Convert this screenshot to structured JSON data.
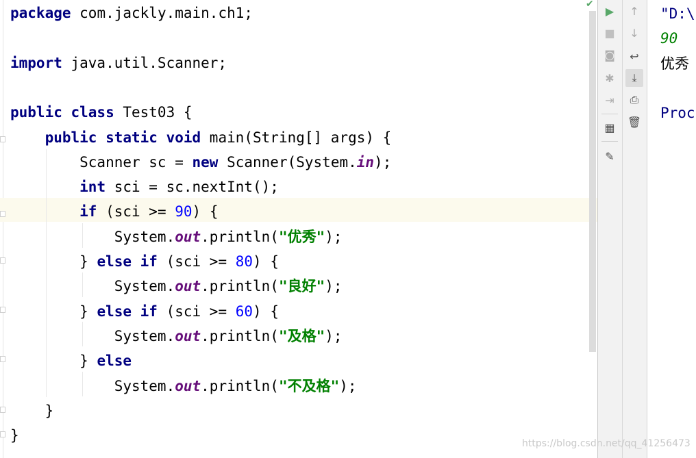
{
  "editor": {
    "lines": [
      [
        {
          "t": "package",
          "c": "kw"
        },
        {
          "t": " com.jackly.main.ch1;",
          "c": ""
        }
      ],
      [],
      [
        {
          "t": "import",
          "c": "kw"
        },
        {
          "t": " java.util.Scanner;",
          "c": ""
        }
      ],
      [],
      [
        {
          "t": "public class",
          "c": "kw"
        },
        {
          "t": " Test03 {",
          "c": ""
        }
      ],
      [
        {
          "t": "    ",
          "c": ""
        },
        {
          "t": "public static void",
          "c": "kw"
        },
        {
          "t": " main(String[] args) {",
          "c": ""
        }
      ],
      [
        {
          "t": "        Scanner sc = ",
          "c": ""
        },
        {
          "t": "new",
          "c": "kw"
        },
        {
          "t": " Scanner(System.",
          "c": ""
        },
        {
          "t": "in",
          "c": "fld"
        },
        {
          "t": ");",
          "c": ""
        }
      ],
      [
        {
          "t": "        ",
          "c": ""
        },
        {
          "t": "int",
          "c": "kw"
        },
        {
          "t": " sci = sc.nextInt();",
          "c": ""
        }
      ],
      [
        {
          "t": "        ",
          "c": ""
        },
        {
          "t": "if",
          "c": "kw"
        },
        {
          "t": " (sci >= ",
          "c": ""
        },
        {
          "t": "90",
          "c": "num"
        },
        {
          "t": ") {",
          "c": ""
        }
      ],
      [
        {
          "t": "            System.",
          "c": ""
        },
        {
          "t": "out",
          "c": "fld"
        },
        {
          "t": ".println(",
          "c": ""
        },
        {
          "t": "\"优秀\"",
          "c": "str"
        },
        {
          "t": ");",
          "c": ""
        }
      ],
      [
        {
          "t": "        } ",
          "c": ""
        },
        {
          "t": "else if",
          "c": "kw"
        },
        {
          "t": " (sci >= ",
          "c": ""
        },
        {
          "t": "80",
          "c": "num"
        },
        {
          "t": ") {",
          "c": ""
        }
      ],
      [
        {
          "t": "            System.",
          "c": ""
        },
        {
          "t": "out",
          "c": "fld"
        },
        {
          "t": ".println(",
          "c": ""
        },
        {
          "t": "\"良好\"",
          "c": "str"
        },
        {
          "t": ");",
          "c": ""
        }
      ],
      [
        {
          "t": "        } ",
          "c": ""
        },
        {
          "t": "else if",
          "c": "kw"
        },
        {
          "t": " (sci >= ",
          "c": ""
        },
        {
          "t": "60",
          "c": "num"
        },
        {
          "t": ") {",
          "c": ""
        }
      ],
      [
        {
          "t": "            System.",
          "c": ""
        },
        {
          "t": "out",
          "c": "fld"
        },
        {
          "t": ".println(",
          "c": ""
        },
        {
          "t": "\"及格\"",
          "c": "str"
        },
        {
          "t": ");",
          "c": ""
        }
      ],
      [
        {
          "t": "        } ",
          "c": ""
        },
        {
          "t": "else",
          "c": "kw"
        }
      ],
      [
        {
          "t": "            System.",
          "c": ""
        },
        {
          "t": "out",
          "c": "fld"
        },
        {
          "t": ".println(",
          "c": ""
        },
        {
          "t": "\"不及格\"",
          "c": "str"
        },
        {
          "t": ");",
          "c": ""
        }
      ],
      [
        {
          "t": "    }",
          "c": ""
        }
      ],
      [
        {
          "t": "}",
          "c": ""
        }
      ]
    ],
    "current_line": 9
  },
  "toolbar": {
    "left": [
      {
        "name": "run-icon",
        "glyph": "▶",
        "color": "#59a869"
      },
      {
        "name": "stop-icon",
        "glyph": "■",
        "color": "#c0c0c0"
      },
      {
        "name": "camera-icon",
        "glyph": "◙",
        "color": "#b0b0b0"
      },
      {
        "name": "bug-icon",
        "glyph": "✱",
        "color": "#b0b0b0"
      },
      {
        "name": "exit-icon",
        "glyph": "⇥",
        "color": "#b0b0b0"
      },
      {
        "name": "layout-icon",
        "glyph": "▦",
        "color": "#505050"
      },
      {
        "name": "pin-icon",
        "glyph": "✎",
        "color": "#505050"
      }
    ],
    "right": [
      {
        "name": "arrow-up-icon",
        "glyph": "↑",
        "color": "#a8a8a8"
      },
      {
        "name": "arrow-down-icon",
        "glyph": "↓",
        "color": "#a8a8a8"
      },
      {
        "name": "soft-wrap-icon",
        "glyph": "↩",
        "color": "#505050"
      },
      {
        "name": "scroll-to-end-icon",
        "glyph": "⤓",
        "color": "#505050"
      },
      {
        "name": "print-icon",
        "glyph": "⎙",
        "color": "#505050"
      },
      {
        "name": "trash-icon",
        "glyph": "🗑",
        "color": "#505050"
      }
    ]
  },
  "console": {
    "lines": [
      {
        "text": "\"D:\\",
        "color": "#000080",
        "italic": false
      },
      {
        "text": "90",
        "color": "#008000",
        "italic": true
      },
      {
        "text": "优秀",
        "color": "#000000",
        "italic": false
      },
      {
        "text": "",
        "color": "#000000",
        "italic": false
      },
      {
        "text": "Proc",
        "color": "#000080",
        "italic": false
      }
    ]
  },
  "status": {
    "check_icon": "check-icon",
    "color": "#59a869"
  },
  "watermark": "https://blog.csdn.net/qq_41256473"
}
